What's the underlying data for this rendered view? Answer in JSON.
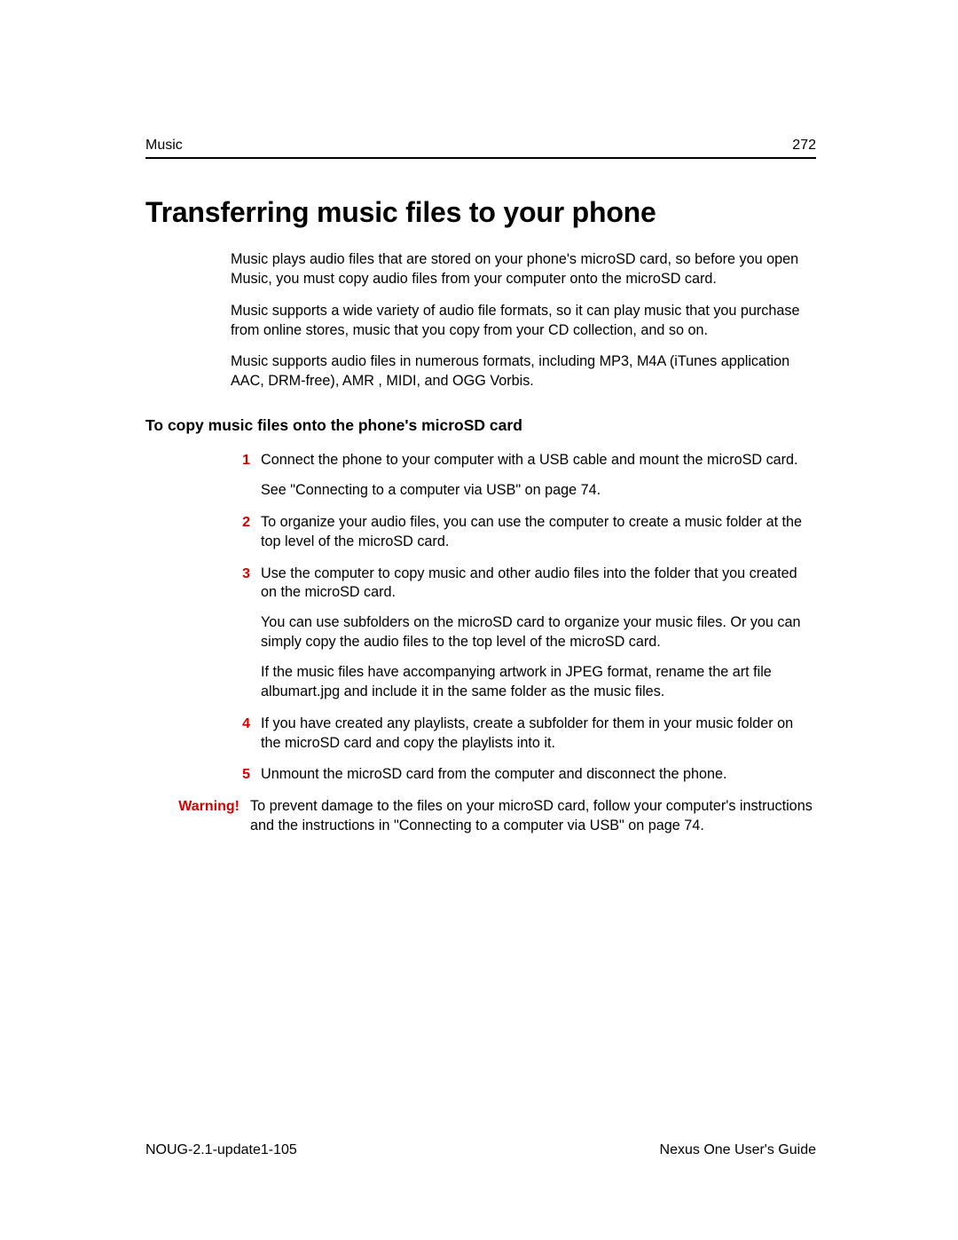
{
  "header": {
    "section": "Music",
    "page_number": "272"
  },
  "title": "Transferring music files to your phone",
  "intro": {
    "p1": "Music plays audio files that are stored on your phone's microSD card, so before you open Music, you must copy audio files from your computer onto the microSD card.",
    "p2": "Music supports a wide variety of audio file formats, so it can play music that you purchase from online stores, music that you copy from your CD collection, and so on.",
    "p3": "Music supports audio files in numerous formats, including MP3, M4A (iTunes application AAC, DRM-free), AMR , MIDI, and OGG Vorbis."
  },
  "subhead": "To copy music files onto the phone's microSD card",
  "steps": [
    {
      "num": "1",
      "paras": [
        "Connect the phone to your computer with a USB cable and mount the microSD card.",
        "See \"Connecting to a computer via USB\" on page 74."
      ]
    },
    {
      "num": "2",
      "paras": [
        "To organize your audio files, you can use the computer to create a music folder at the top level of the microSD card."
      ]
    },
    {
      "num": "3",
      "paras": [
        "Use the computer to copy music and other audio files into the folder that you created on the microSD card.",
        "You can use subfolders on the microSD card to organize your music files. Or you can simply copy the audio files to the top level of the microSD card.",
        "If the music files have accompanying artwork in JPEG format, rename the art file albumart.jpg and include it in the same folder as the music files."
      ]
    },
    {
      "num": "4",
      "paras": [
        "If you have created any playlists, create a subfolder for them in your music folder on the microSD card and copy the playlists into it."
      ]
    },
    {
      "num": "5",
      "paras": [
        "Unmount the microSD card from the computer and disconnect the phone."
      ]
    }
  ],
  "warning": {
    "label": "Warning!",
    "text": "To prevent damage to the files on your microSD card, follow your computer's instructions and the instructions in \"Connecting to a computer via USB\" on page 74."
  },
  "footer": {
    "left": "NOUG-2.1-update1-105",
    "right": "Nexus One User's Guide"
  }
}
